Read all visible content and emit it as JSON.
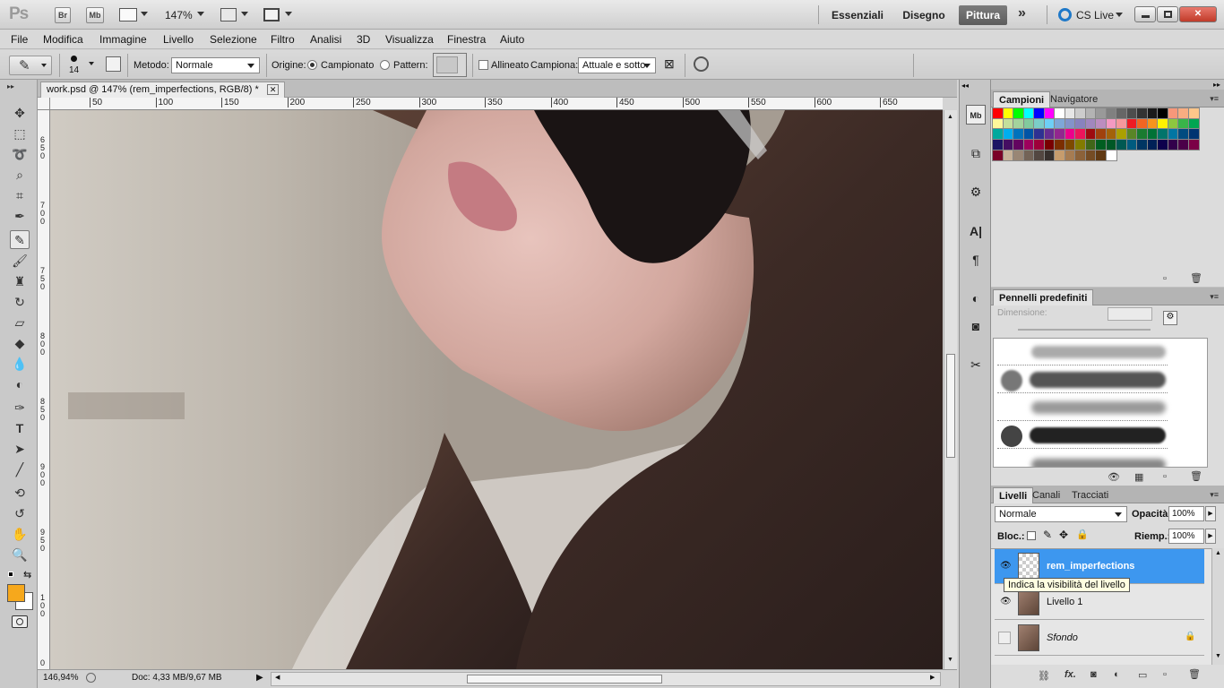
{
  "app": {
    "logo": "Ps",
    "title_buttons": [
      "Br",
      "Mb"
    ],
    "zoom": "147%",
    "workspaces": [
      "Essenziali",
      "Disegno",
      "Pittura"
    ],
    "active_workspace": "Pittura",
    "more": "»",
    "cs_live": "CS Live",
    "window_buttons": [
      "minimize",
      "restore",
      "close"
    ]
  },
  "menu": [
    "File",
    "Modifica",
    "Immagine",
    "Livello",
    "Selezione",
    "Filtro",
    "Analisi",
    "3D",
    "Visualizza",
    "Finestra",
    "Aiuto"
  ],
  "options": {
    "brush_size": "14",
    "metodo_label": "Metodo:",
    "metodo_value": "Normale",
    "origine_label": "Origine:",
    "campionato": "Campionato",
    "pattern": "Pattern:",
    "allineato": "Allineato",
    "campiona_label": "Campiona:",
    "campiona_value": "Attuale e sotto"
  },
  "document": {
    "tab_title": "work.psd @ 147% (rem_imperfections, RGB/8) *",
    "ruler_top": [
      "50",
      "100",
      "150",
      "200",
      "250",
      "300",
      "350",
      "400",
      "450",
      "500",
      "550",
      "600",
      "650"
    ],
    "ruler_left": [
      "6",
      "5",
      "0",
      "7",
      "0",
      "0",
      "7",
      "5",
      "0",
      "8",
      "0",
      "0",
      "8",
      "5",
      "0",
      "9",
      "0",
      "0",
      "9",
      "5",
      "0",
      "1",
      "0",
      "0",
      "0"
    ],
    "zoom_status": "146,94%",
    "doc_status": "Doc: 4,33 MB/9,67 MB"
  },
  "panels": {
    "swatches_tabs": [
      "Campioni",
      "Navigatore"
    ],
    "brushes_tab": "Pennelli predefiniti",
    "dimensione": "Dimensione:",
    "layers_tabs": [
      "Livelli",
      "Canali",
      "Tracciati"
    ],
    "blend_mode": "Normale",
    "opacity_label": "Opacità:",
    "opacity_value": "100%",
    "lock_label": "Bloc.:",
    "fill_label": "Riemp.:",
    "fill_value": "100%",
    "layers": [
      {
        "name": "rem_imperfections",
        "visible": true,
        "selected": true
      },
      {
        "name": "Livello 1",
        "visible": true,
        "selected": false
      },
      {
        "name": "Sfondo",
        "visible": false,
        "selected": false
      }
    ],
    "tooltip": "Indica la visibilità del livello"
  },
  "colors": {
    "foreground": "#f6a81c",
    "background": "#ffffff",
    "selection": "#3d97ef"
  }
}
